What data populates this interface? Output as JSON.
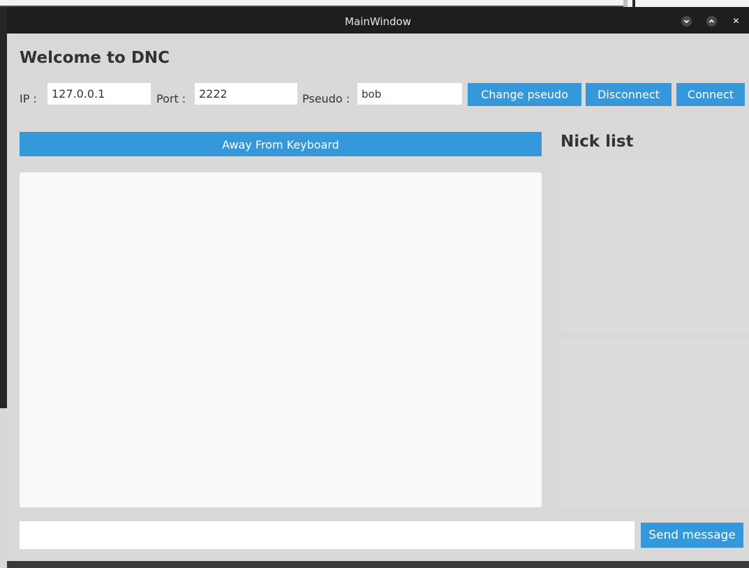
{
  "window": {
    "title": "MainWindow",
    "controls": {
      "minimize_icon": "chevron-down-icon",
      "maximize_icon": "chevron-up-icon",
      "close_icon": "close-icon",
      "close_glyph": "✕"
    }
  },
  "header": {
    "title": "Welcome to DNC"
  },
  "connection": {
    "ip_label": "IP :",
    "ip_value": "127.0.0.1",
    "port_label": "Port :",
    "port_value": "2222",
    "pseudo_label": "Pseudo :",
    "pseudo_value": "bob",
    "change_pseudo_label": "Change pseudo",
    "disconnect_label": "Disconnect",
    "connect_label": "Connect"
  },
  "chat": {
    "status_label": "Away From Keyboard",
    "messages": []
  },
  "nick_list": {
    "title": "Nick list",
    "items": []
  },
  "composer": {
    "message_value": "",
    "send_label": "Send message"
  },
  "colors": {
    "accent": "#3498db",
    "window_bg": "#d9d9d9",
    "titlebar_bg": "#1e1e1e",
    "chat_bg": "#f9f9f9"
  }
}
